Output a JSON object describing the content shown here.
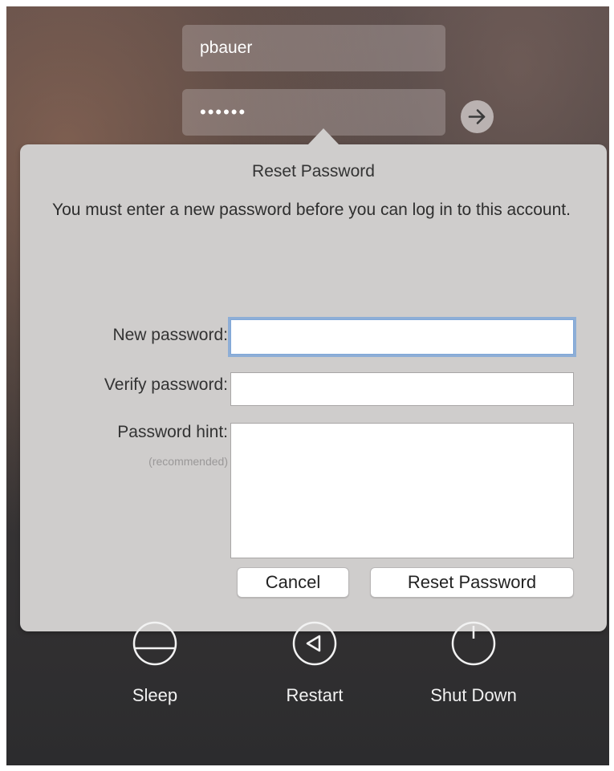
{
  "login": {
    "username": "pbauer",
    "password_mask": "••••••",
    "submit_icon": "arrow-right-icon"
  },
  "reset_dialog": {
    "title": "Reset Password",
    "message": "You must enter a new password before you can log in to this account.",
    "new_password_label": "New password:",
    "verify_password_label": "Verify password:",
    "hint_label": "Password hint:",
    "hint_sublabel": "(recommended)",
    "new_password_value": "",
    "verify_password_value": "",
    "hint_value": "",
    "cancel_label": "Cancel",
    "reset_label": "Reset Password"
  },
  "power_options": [
    {
      "label": "Sleep",
      "icon": "sleep-icon"
    },
    {
      "label": "Restart",
      "icon": "restart-icon"
    },
    {
      "label": "Shut Down",
      "icon": "shutdown-icon"
    }
  ],
  "colors": {
    "dialog_bg": "#cfcdcc",
    "focus_ring": "#6c9cdc"
  }
}
